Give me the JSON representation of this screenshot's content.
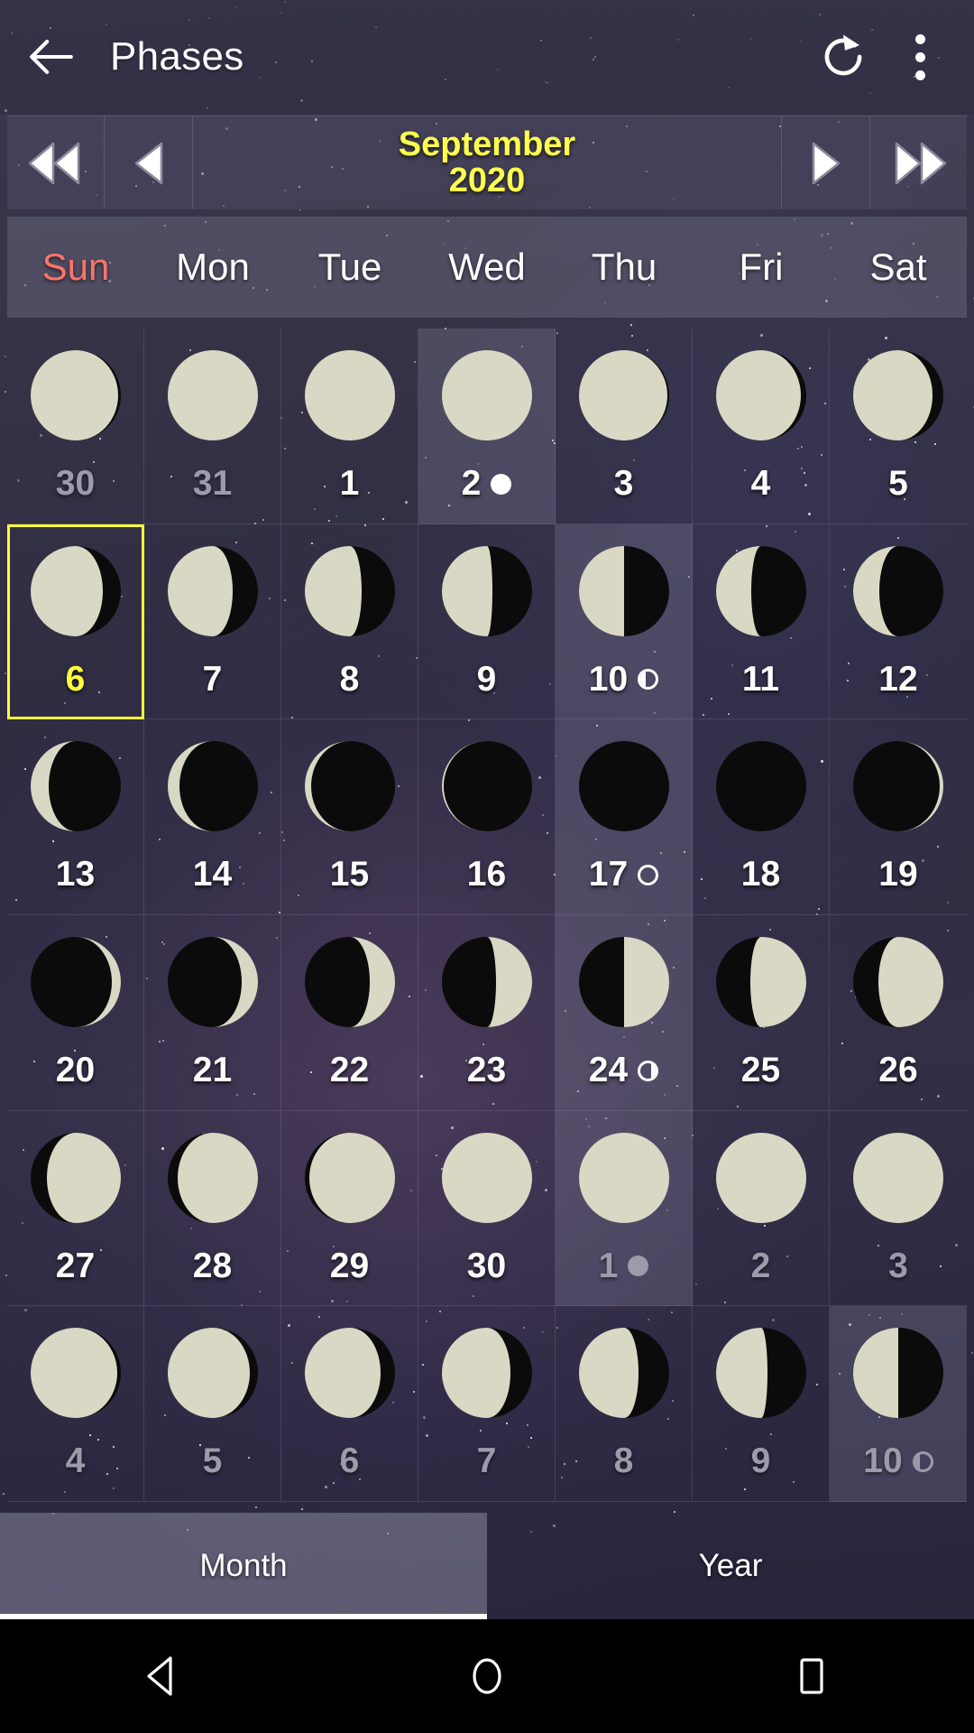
{
  "appbar": {
    "back_icon": "arrow-left-icon",
    "title": "Phases",
    "refresh_icon": "refresh-icon",
    "overflow_icon": "more-vertical-icon"
  },
  "monthbar": {
    "prev_year_icon": "double-chevron-left-icon",
    "prev_month_icon": "chevron-left-icon",
    "month": "September",
    "year": "2020",
    "next_month_icon": "chevron-right-icon",
    "next_year_icon": "double-chevron-right-icon",
    "accent_color": "#ffff4d"
  },
  "weekdays": [
    {
      "label": "Sun",
      "color": "#ff7369"
    },
    {
      "label": "Mon",
      "color": "#ffffff"
    },
    {
      "label": "Tue",
      "color": "#ffffff"
    },
    {
      "label": "Wed",
      "color": "#ffffff"
    },
    {
      "label": "Thu",
      "color": "#ffffff"
    },
    {
      "label": "Fri",
      "color": "#ffffff"
    },
    {
      "label": "Sat",
      "color": "#ffffff"
    }
  ],
  "calendar": {
    "today_day": "6",
    "today_highlight_color": "#ffff3a",
    "days": [
      {
        "day": "30",
        "other_month": true,
        "illum": 0.97,
        "waxing": false,
        "marker": null
      },
      {
        "day": "31",
        "other_month": true,
        "illum": 0.99,
        "waxing": false,
        "marker": null
      },
      {
        "day": "1",
        "other_month": false,
        "illum": 1.0,
        "waxing": false,
        "marker": null
      },
      {
        "day": "2",
        "other_month": false,
        "illum": 1.0,
        "waxing": false,
        "marker": "full",
        "col_highlight": true
      },
      {
        "day": "3",
        "other_month": false,
        "illum": 0.98,
        "waxing": false,
        "marker": null
      },
      {
        "day": "4",
        "other_month": false,
        "illum": 0.94,
        "waxing": false,
        "marker": null
      },
      {
        "day": "5",
        "other_month": false,
        "illum": 0.88,
        "waxing": false,
        "marker": null
      },
      {
        "day": "6",
        "other_month": false,
        "illum": 0.8,
        "waxing": false,
        "marker": null,
        "today": true
      },
      {
        "day": "7",
        "other_month": false,
        "illum": 0.72,
        "waxing": false,
        "marker": null
      },
      {
        "day": "8",
        "other_month": false,
        "illum": 0.63,
        "waxing": false,
        "marker": null
      },
      {
        "day": "9",
        "other_month": false,
        "illum": 0.56,
        "waxing": false,
        "marker": null
      },
      {
        "day": "10",
        "other_month": false,
        "illum": 0.5,
        "waxing": false,
        "marker": "last",
        "col_highlight": true
      },
      {
        "day": "11",
        "other_month": false,
        "illum": 0.39,
        "waxing": false,
        "marker": null
      },
      {
        "day": "12",
        "other_month": false,
        "illum": 0.29,
        "waxing": false,
        "marker": null
      },
      {
        "day": "13",
        "other_month": false,
        "illum": 0.2,
        "waxing": false,
        "marker": null
      },
      {
        "day": "14",
        "other_month": false,
        "illum": 0.13,
        "waxing": false,
        "marker": null
      },
      {
        "day": "15",
        "other_month": false,
        "illum": 0.07,
        "waxing": false,
        "marker": null
      },
      {
        "day": "16",
        "other_month": false,
        "illum": 0.02,
        "waxing": false,
        "marker": null
      },
      {
        "day": "17",
        "other_month": false,
        "illum": 0.0,
        "waxing": true,
        "marker": "new",
        "col_highlight": true
      },
      {
        "day": "18",
        "other_month": false,
        "illum": 0.01,
        "waxing": true,
        "marker": null
      },
      {
        "day": "19",
        "other_month": false,
        "illum": 0.04,
        "waxing": true,
        "marker": null
      },
      {
        "day": "20",
        "other_month": false,
        "illum": 0.1,
        "waxing": true,
        "marker": null
      },
      {
        "day": "21",
        "other_month": false,
        "illum": 0.18,
        "waxing": true,
        "marker": null
      },
      {
        "day": "22",
        "other_month": false,
        "illum": 0.28,
        "waxing": true,
        "marker": null
      },
      {
        "day": "23",
        "other_month": false,
        "illum": 0.4,
        "waxing": true,
        "marker": null
      },
      {
        "day": "24",
        "other_month": false,
        "illum": 0.5,
        "waxing": true,
        "marker": "first",
        "col_highlight": true
      },
      {
        "day": "25",
        "other_month": false,
        "illum": 0.62,
        "waxing": true,
        "marker": null
      },
      {
        "day": "26",
        "other_month": false,
        "illum": 0.72,
        "waxing": true,
        "marker": null
      },
      {
        "day": "27",
        "other_month": false,
        "illum": 0.82,
        "waxing": true,
        "marker": null
      },
      {
        "day": "28",
        "other_month": false,
        "illum": 0.89,
        "waxing": true,
        "marker": null
      },
      {
        "day": "29",
        "other_month": false,
        "illum": 0.95,
        "waxing": true,
        "marker": null
      },
      {
        "day": "30",
        "other_month": false,
        "illum": 0.99,
        "waxing": true,
        "marker": null
      },
      {
        "day": "1",
        "other_month": true,
        "illum": 1.0,
        "waxing": true,
        "marker": "full",
        "col_highlight": true
      },
      {
        "day": "2",
        "other_month": true,
        "illum": 1.0,
        "waxing": false,
        "marker": null
      },
      {
        "day": "3",
        "other_month": true,
        "illum": 0.99,
        "waxing": false,
        "marker": null
      },
      {
        "day": "4",
        "other_month": true,
        "illum": 0.96,
        "waxing": false,
        "marker": null
      },
      {
        "day": "5",
        "other_month": true,
        "illum": 0.91,
        "waxing": false,
        "marker": null
      },
      {
        "day": "6",
        "other_month": true,
        "illum": 0.84,
        "waxing": false,
        "marker": null
      },
      {
        "day": "7",
        "other_month": true,
        "illum": 0.76,
        "waxing": false,
        "marker": null
      },
      {
        "day": "8",
        "other_month": true,
        "illum": 0.66,
        "waxing": false,
        "marker": null
      },
      {
        "day": "9",
        "other_month": true,
        "illum": 0.57,
        "waxing": false,
        "marker": null
      },
      {
        "day": "10",
        "other_month": true,
        "illum": 0.5,
        "waxing": false,
        "marker": "last",
        "col_highlight": true
      }
    ]
  },
  "tabs": [
    {
      "label": "Month",
      "active": true
    },
    {
      "label": "Year",
      "active": false
    }
  ],
  "system_nav": {
    "back_icon": "triangle-back-icon",
    "home_icon": "circle-home-icon",
    "recents_icon": "square-recents-icon"
  }
}
